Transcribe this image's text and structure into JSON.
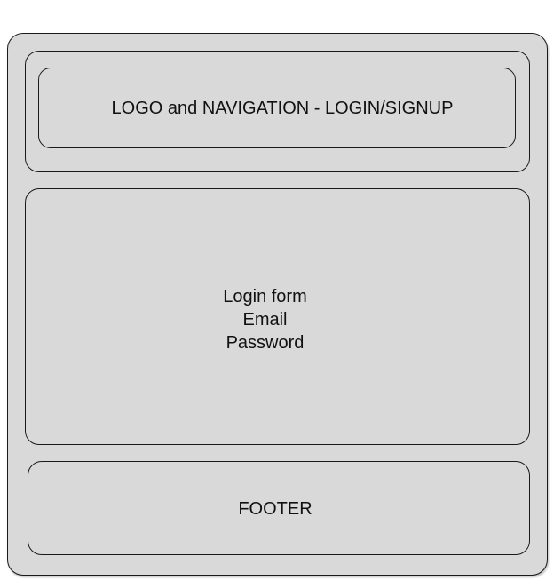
{
  "header": {
    "label": "LOGO and NAVIGATION - LOGIN/SIGNUP"
  },
  "main": {
    "lines": [
      "Login form",
      "Email",
      "Password"
    ]
  },
  "footer": {
    "label": "FOOTER"
  },
  "colors": {
    "box_fill": "#d9d9d9",
    "box_stroke": "#1a1a1a",
    "text": "#111111",
    "background": "#ffffff"
  }
}
